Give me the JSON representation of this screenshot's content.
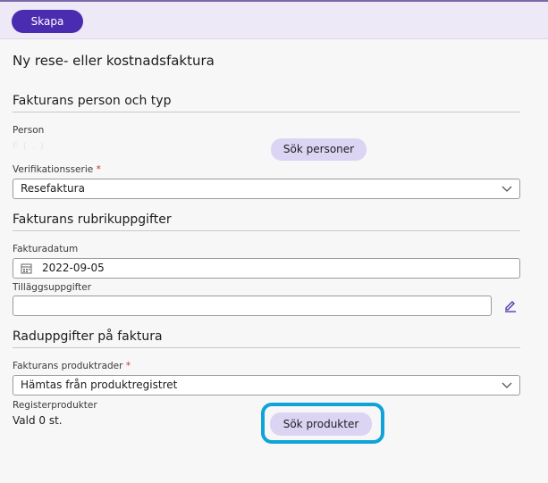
{
  "toolbar": {
    "create_label": "Skapa"
  },
  "page": {
    "title": "Ny rese- eller kostnadsfaktura"
  },
  "section_person": {
    "heading": "Fakturans person och typ",
    "person_label": "Person",
    "person_value_hidden": "F                    ( .      )",
    "search_persons": "Sök personer",
    "series_label": "Verifikationsserie",
    "required_mark": "*",
    "series_value": "Resefaktura"
  },
  "section_header": {
    "heading": "Fakturans rubrikuppgifter",
    "date_label": "Fakturadatum",
    "date_value": "2022-09-05",
    "extra_label": "Tilläggsuppgifter",
    "extra_value": ""
  },
  "section_rows": {
    "heading": "Raduppgifter på faktura",
    "product_rows_label": "Fakturans produktrader",
    "required_mark": "*",
    "product_rows_value": "Hämtas från produktregistret",
    "register_label": "Registerprodukter",
    "selected_text": "Vald 0 st.",
    "search_products": "Sök produkter"
  },
  "icons": {
    "calendar": "calendar-icon",
    "edit": "pencil-icon",
    "chevron": "chevron-down-icon"
  },
  "colors": {
    "primary": "#4a2cb1",
    "pill": "#dcd4f3",
    "highlight": "#0fa3d8",
    "header_bg": "#eee9f6"
  }
}
